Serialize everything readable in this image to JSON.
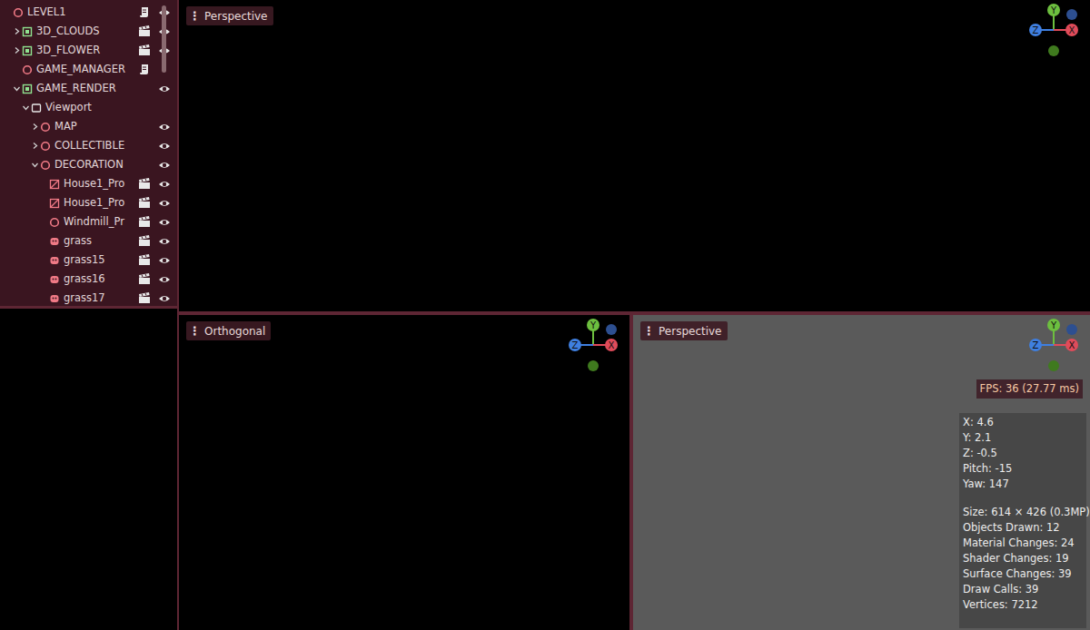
{
  "scene_tree": {
    "items": [
      {
        "label": "LEVEL1",
        "depth": 0,
        "kind": "node",
        "expandable": false,
        "expanded": false,
        "script": true,
        "instance": false,
        "visible_toggle": true
      },
      {
        "label": "3D_CLOUDS",
        "depth": 1,
        "kind": "scene",
        "expandable": true,
        "expanded": false,
        "script": false,
        "instance": true,
        "visible_toggle": true
      },
      {
        "label": "3D_FLOWER",
        "depth": 1,
        "kind": "scene",
        "expandable": true,
        "expanded": false,
        "script": false,
        "instance": true,
        "visible_toggle": true
      },
      {
        "label": "GAME_MANAGER",
        "depth": 1,
        "kind": "node",
        "expandable": false,
        "expanded": false,
        "script": true,
        "instance": false,
        "visible_toggle": false
      },
      {
        "label": "GAME_RENDER",
        "depth": 1,
        "kind": "scene",
        "expandable": true,
        "expanded": true,
        "script": false,
        "instance": false,
        "visible_toggle": true
      },
      {
        "label": "Viewport",
        "depth": 2,
        "kind": "box",
        "expandable": true,
        "expanded": true,
        "script": false,
        "instance": false,
        "visible_toggle": false
      },
      {
        "label": "MAP",
        "depth": 3,
        "kind": "node",
        "expandable": true,
        "expanded": false,
        "script": false,
        "instance": false,
        "visible_toggle": true
      },
      {
        "label": "COLLECTIBLE",
        "depth": 3,
        "kind": "node",
        "expandable": true,
        "expanded": false,
        "script": false,
        "instance": false,
        "visible_toggle": true
      },
      {
        "label": "DECORATION",
        "depth": 3,
        "kind": "node",
        "expandable": true,
        "expanded": true,
        "script": false,
        "instance": false,
        "visible_toggle": true
      },
      {
        "label": "House1_Pro",
        "depth": 4,
        "kind": "mesh",
        "expandable": false,
        "expanded": false,
        "script": false,
        "instance": true,
        "visible_toggle": true
      },
      {
        "label": "House1_Pro",
        "depth": 4,
        "kind": "mesh",
        "expandable": false,
        "expanded": false,
        "script": false,
        "instance": true,
        "visible_toggle": true
      },
      {
        "label": "Windmill_Pr",
        "depth": 4,
        "kind": "node",
        "expandable": false,
        "expanded": false,
        "script": false,
        "instance": true,
        "visible_toggle": true
      },
      {
        "label": "grass",
        "depth": 4,
        "kind": "sprite",
        "expandable": false,
        "expanded": false,
        "script": false,
        "instance": true,
        "visible_toggle": true
      },
      {
        "label": "grass15",
        "depth": 4,
        "kind": "sprite",
        "expandable": false,
        "expanded": false,
        "script": false,
        "instance": true,
        "visible_toggle": true
      },
      {
        "label": "grass16",
        "depth": 4,
        "kind": "sprite",
        "expandable": false,
        "expanded": false,
        "script": false,
        "instance": true,
        "visible_toggle": true
      },
      {
        "label": "grass17",
        "depth": 4,
        "kind": "sprite",
        "expandable": false,
        "expanded": false,
        "script": false,
        "instance": true,
        "visible_toggle": true
      }
    ]
  },
  "viewports": [
    {
      "menu_icon": "⋮",
      "label": "Perspective",
      "gizmo": {
        "y": "Y",
        "z": "Z",
        "x": "X"
      }
    },
    {
      "menu_icon": "⋮",
      "label": "Orthogonal",
      "gizmo": {
        "y": "Y",
        "z": "Z",
        "x": "X"
      }
    },
    {
      "menu_icon": "⋮",
      "label": "Perspective",
      "gizmo": {
        "y": "Y",
        "z": "Z",
        "x": "X"
      }
    }
  ],
  "stats": {
    "fps": "FPS: 36 (27.77 ms)",
    "camera": [
      "X: 4.6",
      "Y: 2.1",
      "Z: -0.5",
      "Pitch: -15",
      "Yaw: 147"
    ],
    "render": [
      "Size: 614 × 426 (0.3MP)",
      "Objects Drawn: 12",
      "Material Changes: 24",
      "Shader Changes: 19",
      "Surface Changes: 39",
      "Draw Calls: 39",
      "Vertices: 7212"
    ]
  }
}
